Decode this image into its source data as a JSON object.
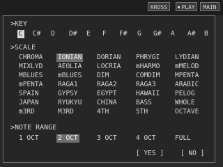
{
  "topbar": {
    "kross": "KROSS",
    "play": "PLAY",
    "main": "MAIN"
  },
  "key": {
    "label": ">KEY",
    "options": [
      "C",
      "C#",
      "D",
      "D#",
      "E",
      "F",
      "F#",
      "G",
      "G#",
      "A",
      "A#",
      "B"
    ],
    "selected": "C"
  },
  "scale": {
    "label": ">SCALE",
    "rows": [
      [
        "CHROMA",
        "IONIAN",
        "DORIAN",
        "PHRYGI",
        "LYDIAN"
      ],
      [
        "MIXLYD",
        "AEOLIA",
        "LOCRIA",
        "mHARMO",
        "mMELOD"
      ],
      [
        "MBLUES",
        "mBLUES",
        "DIM",
        "COMDIM",
        "MPENTA"
      ],
      [
        "mPENTA",
        "RAGA1",
        "RAGA2",
        "RAGA3",
        "ARABIC"
      ],
      [
        "SPAIN",
        "GYPSY",
        "EGYPT",
        "HAWAII",
        "PELOG"
      ],
      [
        "JAPAN",
        "RYUKYU",
        "CHINA",
        "BASS",
        "WHOLE"
      ],
      [
        "m3RD",
        "M3RD",
        "4TH",
        "5TH",
        "OCTAVE"
      ]
    ],
    "selected": "IONIAN"
  },
  "note_range": {
    "label": ">NOTE RANGE",
    "options": [
      "1 OCT",
      "2 OCT",
      "3 OCT",
      "4 OCT",
      "FULL"
    ],
    "selected": "2 OCT"
  },
  "buttons": {
    "yes": "[ YES ]",
    "no": "[ NO ]"
  }
}
